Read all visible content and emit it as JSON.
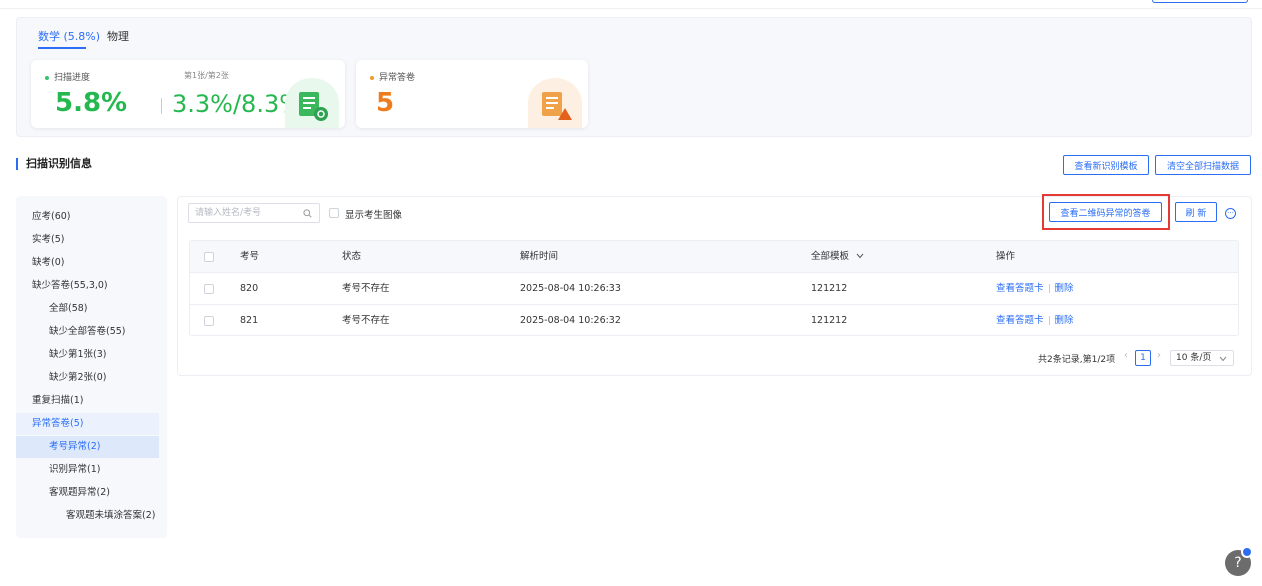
{
  "subject_tabs": [
    "数学 (5.8%)",
    "物理"
  ],
  "scan_card": {
    "label": "扫描进度",
    "pages": "第1张/第2张",
    "percent": "5.8%",
    "ratio": "3.3%/8.3%"
  },
  "abnormal_card": {
    "label": "异常答卷",
    "count": "5"
  },
  "section_title": "扫描识别信息",
  "header_buttons": {
    "new_template": "查看新识别模板",
    "clear_all": "清空全部扫描数据"
  },
  "left_tree": [
    {
      "label": "应考(60)"
    },
    {
      "label": "实考(5)"
    },
    {
      "label": "缺考(0)"
    },
    {
      "label": "缺少答卷(55,3,0)"
    },
    {
      "label": "全部(58)"
    },
    {
      "label": "缺少全部答卷(55)"
    },
    {
      "label": "缺少第1张(3)"
    },
    {
      "label": "缺少第2张(0)"
    },
    {
      "label": "重复扫描(1)"
    },
    {
      "label": "异常答卷(5)"
    },
    {
      "label": "考号异常(2)"
    },
    {
      "label": "识别异常(1)"
    },
    {
      "label": "客观题异常(2)"
    },
    {
      "label": "客观题未填涂答案(2)"
    }
  ],
  "toolbar": {
    "search_placeholder": "请输入姓名/考号",
    "show_image_label": "显示考生图像",
    "qr_abnormal_button": "查看二维码异常的答卷",
    "refresh_button": "刷 新"
  },
  "table": {
    "headers": {
      "exam_no": "考号",
      "status": "状态",
      "parse_time": "解析时间",
      "template": "全部模板",
      "actions": "操作"
    },
    "rows": [
      {
        "exam_no": "820",
        "status": "考号不存在",
        "parse_time": "2025-08-04 10:26:33",
        "template": "121212",
        "view": "查看答题卡",
        "delete": "删除"
      },
      {
        "exam_no": "821",
        "status": "考号不存在",
        "parse_time": "2025-08-04 10:26:32",
        "template": "121212",
        "view": "查看答题卡",
        "delete": "删除"
      }
    ]
  },
  "pagination": {
    "info": "共2条记录,第1/2项",
    "current_page": "1",
    "page_size": "10 条/页"
  },
  "colors": {
    "accent": "#2b6ef5",
    "progress_green": "#25b84e",
    "abnormal_orange": "#ef7c1c",
    "highlight_red": "#e53935"
  }
}
